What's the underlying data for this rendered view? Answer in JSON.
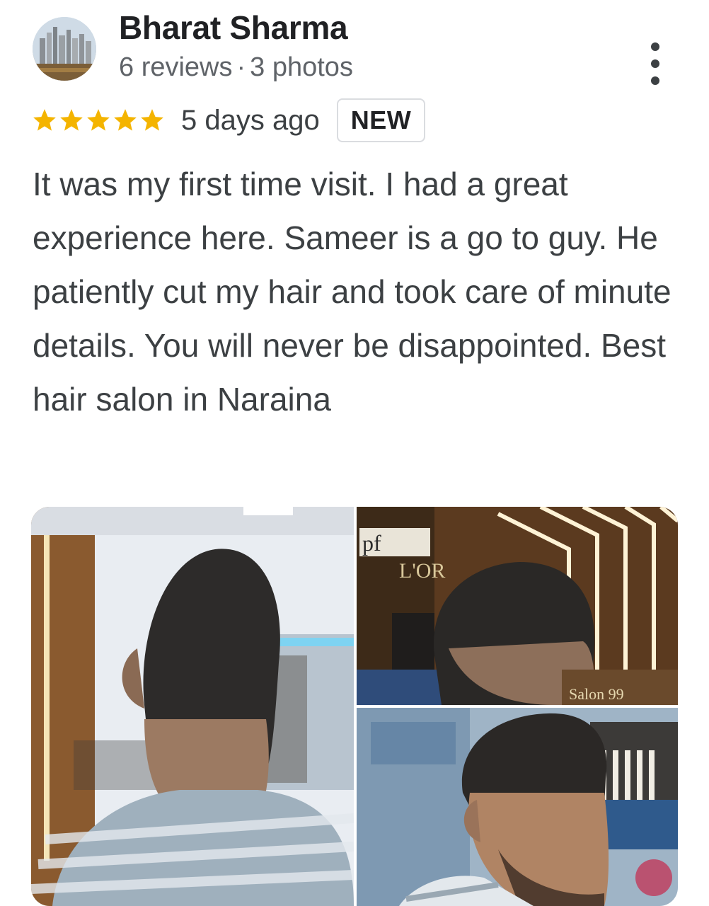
{
  "author": {
    "name": "Bharat Sharma",
    "reviews": "6 reviews",
    "separator": "·",
    "photos": "3 photos"
  },
  "review": {
    "rating": 5,
    "max_rating": 5,
    "date": "5 days ago",
    "badge": "NEW",
    "text": "It was my first time visit. I had a great experience here. Sameer is a go to guy. He patiently cut my hair and took care of minute details. You will never be disappointed. Best hair salon in Naraina"
  },
  "photos": {
    "items": [
      {
        "icon": "photo-haircut-back"
      },
      {
        "icon": "photo-haircut-salon",
        "sign_left": "pf",
        "sign_right": "L'OR",
        "sign_salon": "Salon 99"
      },
      {
        "icon": "photo-haircut-side"
      }
    ]
  },
  "colors": {
    "star": "#f4b400",
    "text_primary": "#202124",
    "text_secondary": "#5f6368",
    "badge_border": "#dadce0"
  },
  "icons": {
    "more": "more-vert-icon",
    "star": "star-icon"
  }
}
